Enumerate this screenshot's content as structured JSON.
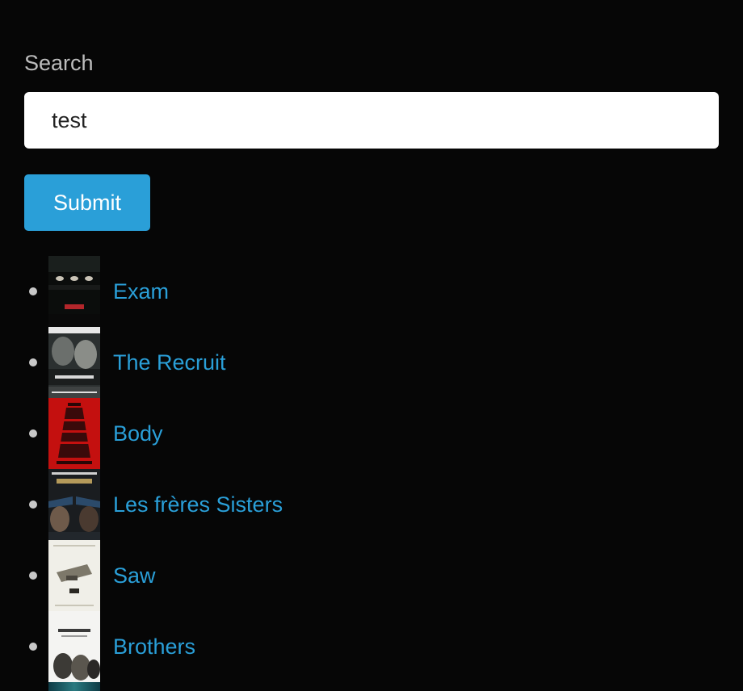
{
  "search": {
    "label": "Search",
    "value": "test",
    "submit_label": "Submit"
  },
  "results": [
    {
      "title": "Exam",
      "poster_icon": "exam-poster-icon"
    },
    {
      "title": "The Recruit",
      "poster_icon": "the-recruit-poster-icon"
    },
    {
      "title": "Body",
      "poster_icon": "body-poster-icon"
    },
    {
      "title": "Les frères Sisters",
      "poster_icon": "les-freres-sisters-poster-icon"
    },
    {
      "title": "Saw",
      "poster_icon": "saw-poster-icon"
    },
    {
      "title": "Brothers",
      "poster_icon": "brothers-poster-icon"
    }
  ],
  "colors": {
    "background": "#060606",
    "accent": "#2a9fd8",
    "text": "#c8c8c8"
  }
}
